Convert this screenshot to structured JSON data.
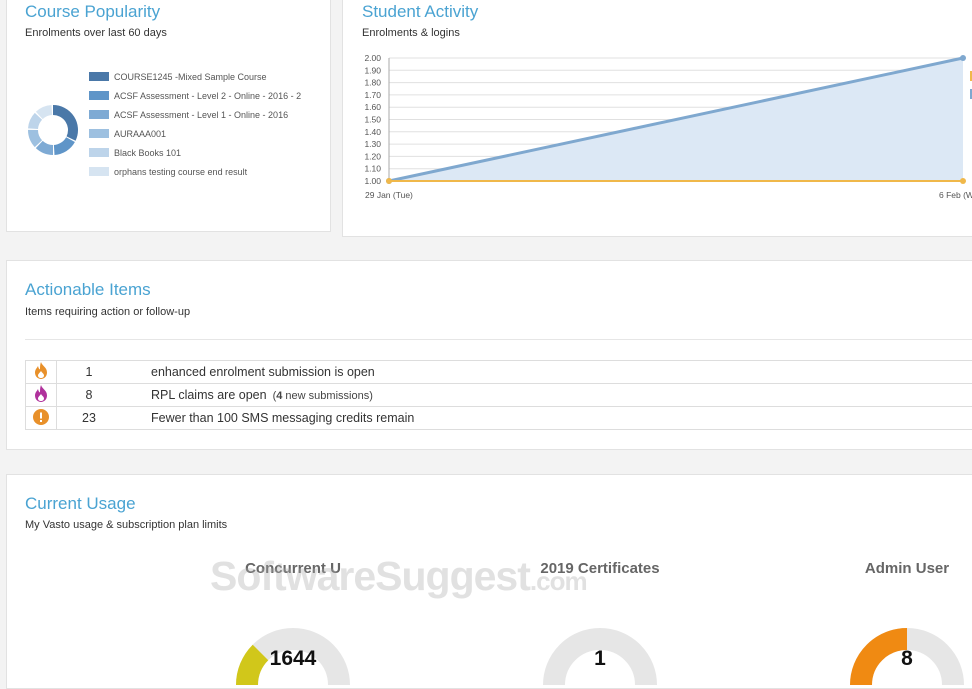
{
  "course_popularity": {
    "title": "Course Popularity",
    "subtitle": "Enrolments over last 60 days",
    "legend": [
      {
        "label": "COURSE1245 -Mixed Sample Course",
        "color": "#4a78a8"
      },
      {
        "label": "ACSF Assessment - Level 2 - Online - 2016 - 2",
        "color": "#5f95c8"
      },
      {
        "label": "ACSF Assessment - Level 1 - Online - 2016",
        "color": "#7eaad4"
      },
      {
        "label": "AURAAA001",
        "color": "#9dc0e0"
      },
      {
        "label": "Black Books 101",
        "color": "#bdd4ea"
      },
      {
        "label": "orphans testing course end result",
        "color": "#d6e4f1"
      }
    ]
  },
  "student_activity": {
    "title": "Student Activity",
    "subtitle": "Enrolments & logins"
  },
  "chart_data": {
    "type": "area",
    "x": [
      "29 Jan (Tue)",
      "6 Feb (W"
    ],
    "series": [
      {
        "values": [
          1.0,
          2.0
        ],
        "color": "#7fa8cf",
        "fill": "#dce8f5"
      },
      {
        "values": [
          1.0,
          1.0
        ],
        "color": "#f0b84a"
      }
    ],
    "ylim": [
      1.0,
      2.0
    ],
    "yticks": [
      "1.00",
      "1.10",
      "1.20",
      "1.30",
      "1.40",
      "1.50",
      "1.60",
      "1.70",
      "1.80",
      "1.90",
      "2.00"
    ],
    "grid": true
  },
  "actionable": {
    "title": "Actionable Items",
    "subtitle": "Items requiring action or follow-up",
    "rows": [
      {
        "icon": "flame-icon",
        "count": "1",
        "text": "enhanced enrolment submission is open",
        "new_count": "",
        "new_text": "",
        "color": "#e8902a"
      },
      {
        "icon": "flame-icon",
        "count": "8",
        "text": "RPL claims are open",
        "new_count": "4",
        "new_text": " new submissions)",
        "color": "#b0329c"
      },
      {
        "icon": "alert-icon",
        "count": "23",
        "text": "Fewer than 100 SMS messaging credits remain",
        "new_count": "",
        "new_text": "",
        "color": "#e8902a"
      }
    ]
  },
  "usage": {
    "title": "Current Usage",
    "subtitle": "My Vasto usage & subscription plan limits",
    "gauges": [
      {
        "label": "Concurrent U",
        "value": "1644",
        "fraction": 0.25,
        "color": "#d1c71a"
      },
      {
        "label": "2019 Certificates",
        "value": "1",
        "fraction": 0.0,
        "color": "#d1c71a"
      },
      {
        "label": "Admin User",
        "value": "8",
        "fraction": 0.5,
        "color": "#f08a12"
      }
    ]
  },
  "watermark": {
    "main": "SoftwareSuggest",
    "suffix": ".com"
  }
}
